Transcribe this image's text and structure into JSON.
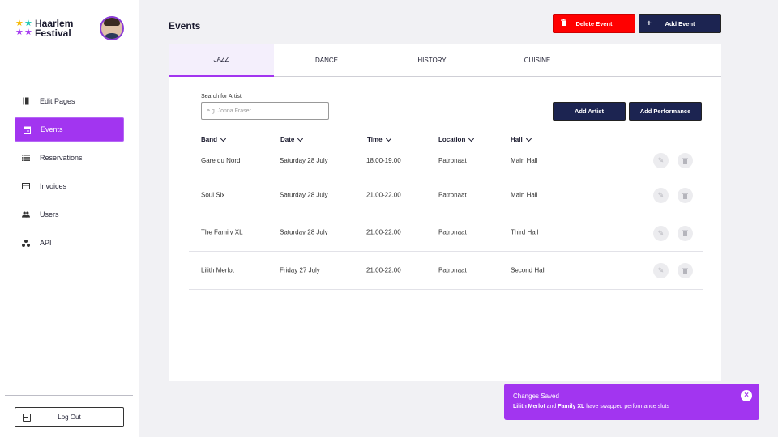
{
  "brand": {
    "logo_line1": "Haarlem",
    "logo_line2": "Festival",
    "star_colors": [
      "#f5b700",
      "#1fc8b4",
      "#a235f0",
      "#a235f0"
    ]
  },
  "sidebar": {
    "items": [
      {
        "label": "Edit Pages",
        "icon": "pages-icon"
      },
      {
        "label": "Events",
        "icon": "calendar-icon",
        "active": true
      },
      {
        "label": "Reservations",
        "icon": "list-icon"
      },
      {
        "label": "Invoices",
        "icon": "card-icon"
      },
      {
        "label": "Users",
        "icon": "users-icon"
      },
      {
        "label": "API",
        "icon": "api-icon"
      }
    ],
    "logout_label": "Log Out"
  },
  "header": {
    "title": "Events",
    "delete_label": "Delete Event",
    "add_label": "Add Event"
  },
  "tabs": [
    {
      "label": "JAZZ",
      "active": true
    },
    {
      "label": "DANCE"
    },
    {
      "label": "HISTORY"
    },
    {
      "label": "CUISINE"
    }
  ],
  "search": {
    "label": "Search for Artist",
    "placeholder": "e.g. Jonna Fraser..."
  },
  "actions": {
    "add_artist": "Add Artist",
    "add_performance": "Add Performance"
  },
  "table": {
    "columns": [
      "Band",
      "Date",
      "Time",
      "Location",
      "Hall"
    ],
    "rows": [
      [
        "Gare du Nord",
        "Saturday 28 July",
        "18.00-19.00",
        "Patronaat",
        "Main Hall"
      ],
      [
        "Soul Six",
        "Saturday 28 July",
        "21.00-22.00",
        "Patronaat",
        "Main Hall"
      ],
      [
        "The Family XL",
        "Saturday 28 July",
        "21.00-22.00",
        "Patronaat",
        "Third Hall"
      ],
      [
        "Lilith Merlot",
        "Friday 27 July",
        "21.00-22.00",
        "Patronaat",
        "Second Hall"
      ]
    ]
  },
  "toast": {
    "title": "Changes Saved",
    "name1": "Lilith Merlot",
    "connector": " and ",
    "name2": "Family XL",
    "rest": " have swapped performance slots"
  },
  "colors": {
    "accent": "#a235f0",
    "navy": "#1c2451",
    "danger": "#ff0000"
  }
}
